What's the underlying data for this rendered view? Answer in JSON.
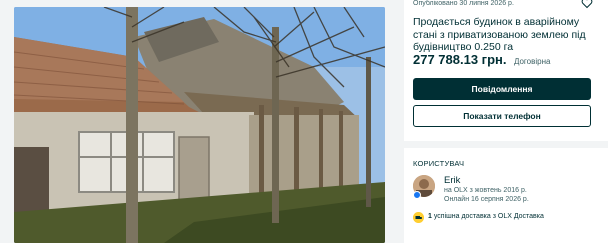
{
  "listing": {
    "posted": "Опубліковано 30 липня 2026 р.",
    "title": "Продається будинок в аварійному стані з приватизованою землею під будівництво 0.250 га",
    "price": "277 788.13 грн.",
    "price_note": "Договірна"
  },
  "actions": {
    "message_label": "Повідомлення",
    "phone_label": "Показати телефон"
  },
  "user": {
    "heading": "КОРИСТУВАЧ",
    "name": "Erik",
    "joined": "на OLX з жовтень 2016 р.",
    "online": "Онлайн 16 серпня 2026 р.",
    "delivery_count": "1",
    "delivery_text": "успішна доставка з OLX Доставка"
  },
  "colors": {
    "primary": "#002f34",
    "delivery_badge": "#ffce32"
  }
}
